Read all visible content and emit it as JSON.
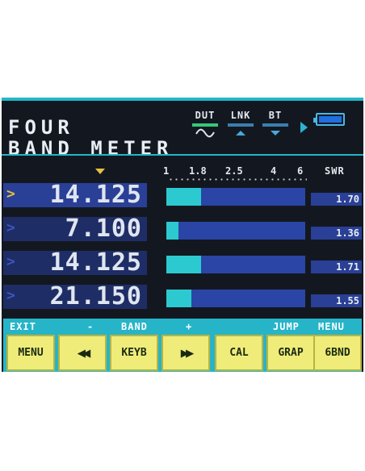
{
  "header": {
    "title_line1": "FOUR",
    "title_line2": "BAND METER",
    "indicators": [
      {
        "label": "DUT",
        "symbol": "sine-wave-icon",
        "bar_color": "#36c878"
      },
      {
        "label": "LNK",
        "symbol": "triangle-up-icon",
        "bar_color": "#3a7fb0"
      },
      {
        "label": "BT",
        "symbol": "triangle-down-icon",
        "bar_color": "#3a7fb0"
      }
    ],
    "battery_icon": "battery-icon"
  },
  "scale": {
    "ticks": [
      "1",
      "1.8",
      "2.5",
      "4",
      "6"
    ],
    "swr_header": "SWR"
  },
  "bands": [
    {
      "frequency": "14.125",
      "swr": "1.70",
      "meter_fraction": 0.25,
      "selected": true
    },
    {
      "frequency": " 7.100",
      "swr": "1.36",
      "meter_fraction": 0.09,
      "selected": false
    },
    {
      "frequency": "14.125",
      "swr": "1.71",
      "meter_fraction": 0.25,
      "selected": false
    },
    {
      "frequency": "21.150",
      "swr": "1.55",
      "meter_fraction": 0.18,
      "selected": false
    }
  ],
  "softkeys": {
    "labels": {
      "exit": "EXIT",
      "minus": "-",
      "band": "BAND",
      "plus": "+",
      "jump": "JUMP",
      "menu": "MENU"
    },
    "keys": [
      "MENU",
      "rewind-icon",
      "KEYB",
      "fast-forward-icon",
      "CAL",
      "GRAP",
      "6BND"
    ]
  },
  "colors": {
    "accent": "#23b6c8",
    "key_yellow": "#f0ec7a",
    "meter_fill": "#2ccad0",
    "selection": "#e6c040"
  }
}
